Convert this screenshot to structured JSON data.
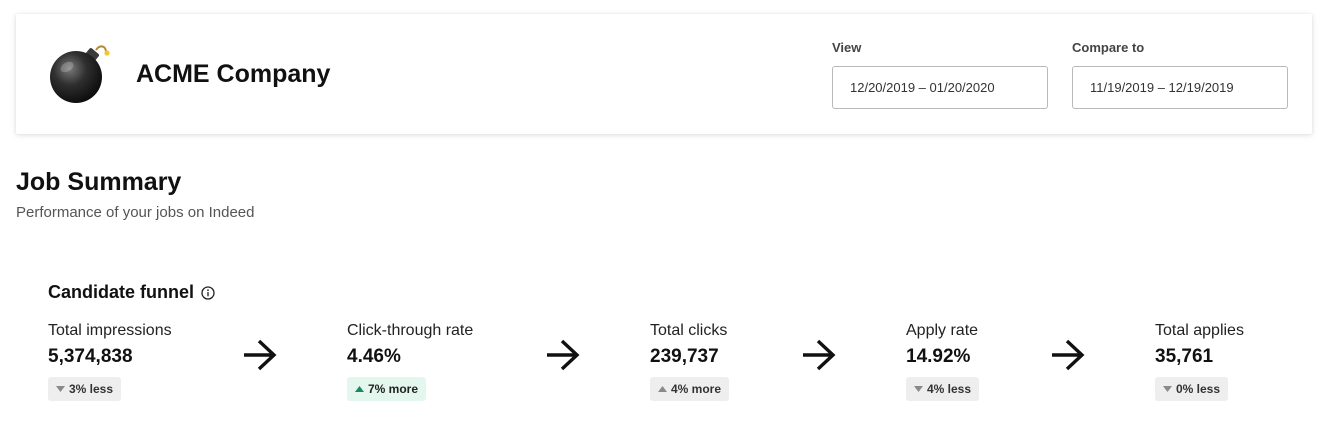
{
  "header": {
    "company_name": "ACME Company",
    "view": {
      "label": "View",
      "value": "12/20/2019 – 01/20/2020"
    },
    "compare": {
      "label": "Compare to",
      "value": "11/19/2019 – 12/19/2019"
    }
  },
  "summary": {
    "title": "Job Summary",
    "subtitle": "Performance of your jobs on Indeed"
  },
  "funnel": {
    "title": "Candidate funnel",
    "metrics": [
      {
        "label": "Total impressions",
        "value": "5,374,838",
        "change": "3% less",
        "direction": "down"
      },
      {
        "label": "Click-through rate",
        "value": "4.46%",
        "change": "7% more",
        "direction": "up"
      },
      {
        "label": "Total clicks",
        "value": "239,737",
        "change": "4% more",
        "direction": "up"
      },
      {
        "label": "Apply rate",
        "value": "14.92%",
        "change": "4% less",
        "direction": "down"
      },
      {
        "label": "Total applies",
        "value": "35,761",
        "change": "0% less",
        "direction": "down"
      }
    ]
  },
  "colors": {
    "positive_badge_bg": "#e3f7ef",
    "positive_arrow": "#1a8a5a",
    "neutral_badge_bg": "#eeeeee",
    "neutral_arrow": "#8a8a8a"
  },
  "icons": {
    "logo": "bomb-icon",
    "info": "info-icon",
    "arrow": "arrow-right-icon",
    "up": "triangle-up-icon",
    "down": "triangle-down-icon"
  }
}
